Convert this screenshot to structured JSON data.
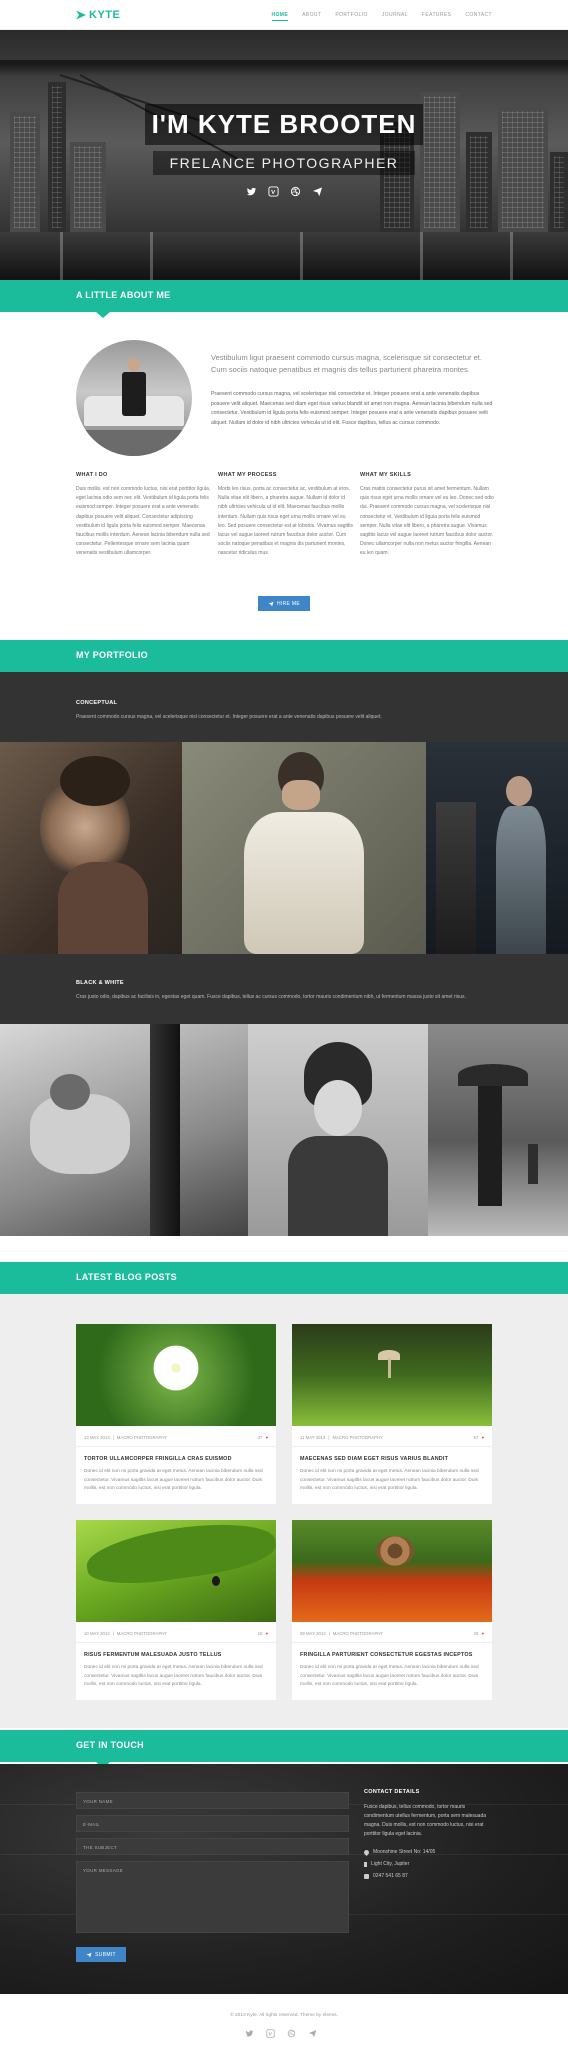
{
  "nav": {
    "brand": "KYTE",
    "items": [
      {
        "label": "HOME",
        "active": true
      },
      {
        "label": "ABOUT",
        "active": false
      },
      {
        "label": "PORTFOLIO",
        "active": false
      },
      {
        "label": "JOURNAL",
        "active": false
      },
      {
        "label": "FEATURES",
        "active": false
      },
      {
        "label": "CONTACT",
        "active": false
      }
    ]
  },
  "hero": {
    "title": "I'M KYTE BROOTEN",
    "subtitle": "FRELANCE PHOTOGRAPHER",
    "social_icons": [
      "twitter-icon",
      "vimeo-icon",
      "dribbble-icon",
      "send-icon"
    ]
  },
  "about": {
    "heading": "A LITTLE ABOUT ME",
    "lead": "Vestibulum ligut praesent commodo cursus magna, scelerisque sit consectetur et. Cum sociis natoque penatibus et magnis dis tellus parturient pharetra montes.",
    "body": "Praesent commodo cursus magna, vel scelerisque nisl consectetur et. Integer posuere erat a ante venenatis dapibus posuere velit aliquet. Maecenas sed diam eget risus varius blandit sit amet non magna. Aenean lacinia bibendum nulla sed consectetur. Vestibulum id ligula porta felis euismod semper. Integer posuere erat a ante venenatis dapibus posuere velit aliquet. Nullam id dolor id nibh ultricies vehicula ut id elit. Fusce dapibus, tellus ac cursus commodo.",
    "columns": [
      {
        "title": "WHAT I DO",
        "text": "Duis mollis, est non commodo luctus, nisi erat porttitor ligula, eget lacinia odio sem nec elit. Vestibulum id ligula porta felis euismod semper. Integer posuere erat a ante venenatis dapibus posuere velit aliquet. Consectetur adipiscing vestibulum id ligula porta felis euismod semper. Maecenas faucibus mollis interdum. Aenean lacinia bibendum nulla sed consectetur. Pellentesque ornare sem lacinia quam venenatis vestibulum ullamcorper."
      },
      {
        "title": "WHAT MY PROCESS",
        "text": "Morbi leo risus, porta ac consectetur ac, vestibulum at eros. Nulla vitae elit libero, a pharetra augue. Nullam id dolor id nibh ultricies vehicula ut id elit. Maecenas faucibus mollis interdum. Nullam quis risus eget urna mollis ornare vel eu leo. Sed posuere consectetur est at lobortis. Vivamus sagittis lacus vel augue laoreet rutrum faucibus dolor auctor. Cum sociis natoque penatibus et magnis dis parturient montes, nascetur ridiculus mus."
      },
      {
        "title": "WHAT MY SKILLS",
        "text": "Cras mattis consectetur purus sit amet fermentum. Nullam quis risus eget urna mollis ornare vel eu leo. Donec sed odio dui. Praesent commodo cursus magna, vel scelerisque nisl consectetur et. Vestibulum id ligula porta felis euismod semper. Nulla vitae elit libero, a pharetra augue. Vivamus sagittis lacus vel augue laoreet rutrum faucibus dolor auctor. Donec ullamcorper nulla non metus auctor fringilla. Aenean eu leo quam."
      }
    ],
    "hire_label": "HIRE ME"
  },
  "portfolio": {
    "heading": "MY PORTFOLIO",
    "galleries": [
      {
        "title": "CONCEPTUAL",
        "desc": "Praesent commodo cursus magna, vel scelerisque nisl consectetur et. Integer posuere erat a ante venenatis dapibus posuere velit aliquet."
      },
      {
        "title": "BLACK & WHITE",
        "desc": "Cras justo odio, dapibus ac facilisis in, egestas eget quam. Fusce dapibus, tellus ac cursus commodo, tortor mauris condimentum nibh, ut fermentum massa justo sit amet risus."
      }
    ]
  },
  "blog": {
    "heading": "LATEST BLOG POSTS",
    "posts": [
      {
        "date": "13 MAY 2013",
        "category": "MACRO PHOTOGRAPHY",
        "count": "37",
        "title": "TORTOR ULLAMCORPER FRINGILLA CRAS EUISMOD",
        "excerpt": "Donec id elit non mi porta gravida at eget metus. Aenean lacinia bibendum nulla sed consectetur. Vivamus sagittis lacus augue laoreet rutrum faucibus dolor auctor. Duis mollis, est non commodo luctus, nisi erat porttitor ligula."
      },
      {
        "date": "11 MAY 2013",
        "category": "MACRO PHOTOGRAPHY",
        "count": "57",
        "title": "MAECENAS SED DIAM EGET RISUS VARIUS BLANDIT",
        "excerpt": "Donec id elit non mi porta gravida at eget metus. Aenean lacinia bibendum nulla sed consectetur. Vivamus sagittis lacus augue laoreet rutrum faucibus dolor auctor. Duis mollis, est non commodo luctus, nisi erat porttitor ligula."
      },
      {
        "date": "10 MAY 2013",
        "category": "MACRO PHOTOGRAPHY",
        "count": "16",
        "title": "RISUS FERMENTUM MALESUADA JUSTO TELLUS",
        "excerpt": "Donec id elit non mi porta gravida at eget metus. Aenean lacinia bibendum nulla sed consectetur. Vivamus sagittis lacus augue laoreet rutrum faucibus dolor auctor. Duis mollis, est non commodo luctus, nisi erat porttitor ligula."
      },
      {
        "date": "09 MAY 2013",
        "category": "MACRO PHOTOGRAPHY",
        "count": "26",
        "title": "FRINGILLA PARTURIENT CONSECTETUR EGESTAS INCEPTOS",
        "excerpt": "Donec id elit non mi porta gravida at eget metus. Aenean lacinia bibendum nulla sed consectetur. Vivamus sagittis lacus augue laoreet rutrum faucibus dolor auctor. Duis mollis, est non commodo luctus, nisi erat porttitor ligula."
      }
    ]
  },
  "contact": {
    "heading": "GET IN TOUCH",
    "name_placeholder": "YOUR NAME",
    "email_placeholder": "E-MAIL",
    "subject_placeholder": "THE SUBJECT",
    "message_placeholder": "YOUR MESSAGE",
    "submit_label": "SUBMIT",
    "details_title": "CONTACT DETAILS",
    "details_text": "Fusce dapibus, tellus commodo, tortor mauris condimentum utellus fermentum, porta sem malesuada magna. Duis mollis, est non commodo luctus, nisi erat porttitor ligula eget lacinia.",
    "address": "Moonshine Street No: 14/05",
    "city": "Light City, Jupiter",
    "phone": "0247 541 65 87"
  },
  "footer": {
    "copyright": "© 2013 Kyte. All rights reserved. Theme by elemis."
  },
  "colors": {
    "accent": "#1abc9c",
    "button": "#3f86c8",
    "dark": "#333333"
  }
}
